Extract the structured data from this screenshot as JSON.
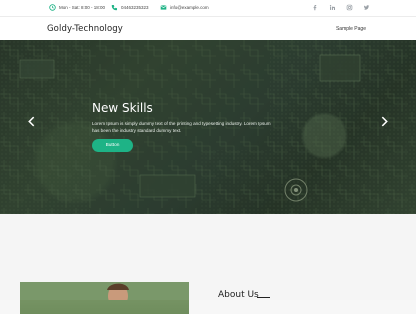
{
  "topbar": {
    "hours": "Mon - Sat: 8:00 - 18:00",
    "phone": "04463235323",
    "email": "info@example.com",
    "social": [
      "facebook-icon",
      "linkedin-icon",
      "instagram-icon",
      "twitter-icon"
    ]
  },
  "navbar": {
    "brand": "Goldy-Technology",
    "link": "Sample Page"
  },
  "hero": {
    "title": "New Skills",
    "text": "Lorem Ipsum is simply dummy text of the printing and typesetting industry. Lorem Ipsum has been the industry standard dummy text.",
    "button": "Button"
  },
  "about": {
    "title": "About Us"
  },
  "colors": {
    "accent": "#1eb386",
    "social": "#9aa0a6"
  }
}
